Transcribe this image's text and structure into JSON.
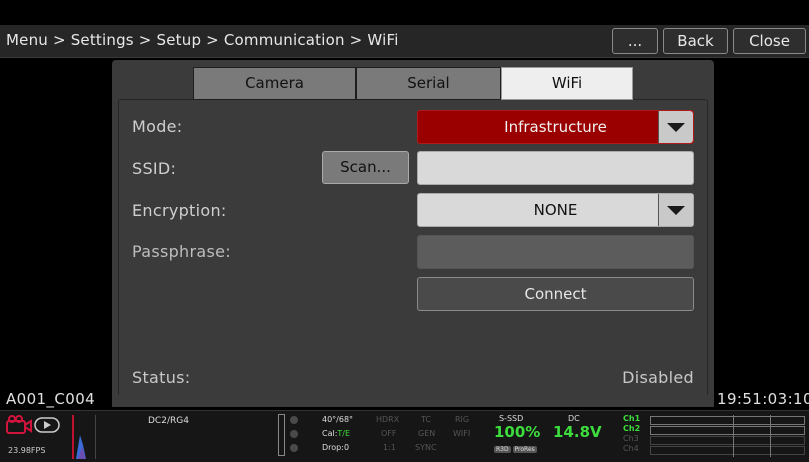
{
  "header": {
    "breadcrumb": "Menu > Settings > Setup > Communication > WiFi",
    "more_label": "...",
    "back_label": "Back",
    "close_label": "Close"
  },
  "tabs": [
    {
      "label": "Camera",
      "active": false
    },
    {
      "label": "Serial",
      "active": false
    },
    {
      "label": "WiFi",
      "active": true
    }
  ],
  "form": {
    "mode_label": "Mode:",
    "mode_value": "Infrastructure",
    "ssid_label": "SSID:",
    "ssid_value": "",
    "scan_label": "Scan...",
    "encryption_label": "Encryption:",
    "encryption_value": "NONE",
    "passphrase_label": "Passphrase:",
    "passphrase_value": "",
    "connect_label": "Connect",
    "status_label": "Status:",
    "status_value": "Disabled"
  },
  "overlay": {
    "clip_name": "A001_C004",
    "timecode": "19:51:03:10"
  },
  "statusbar": {
    "fps": "23.98FPS",
    "preset": "DC2/RG4",
    "temp": "40°/68°",
    "cal_prefix": "Cal:",
    "cal_value": "T/E",
    "drop": "Drop:0",
    "hdrx": "HDRX",
    "hdrx_val": "OFF",
    "ratio": "1:1",
    "tc": "TC",
    "tc_val": "GEN",
    "sync": "SYNC",
    "rig": "RIG",
    "wifi": "WIFI",
    "media_label": "S-SSD",
    "media_value": "100%",
    "media_codec1": "R3D",
    "media_codec2": "ProRes",
    "power_label": "DC",
    "power_value": "14.8V",
    "channels": [
      "Ch1",
      "Ch2",
      "Ch3",
      "Ch4"
    ],
    "colors": {
      "accent_red": "#9b0000",
      "status_green": "#3ddc3d"
    }
  }
}
